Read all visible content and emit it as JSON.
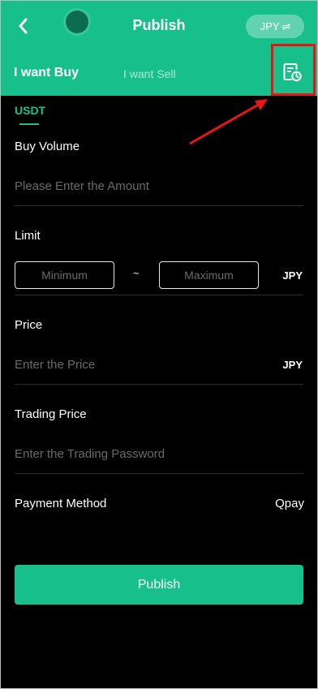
{
  "header": {
    "title": "Publish",
    "currency": "JPY",
    "currency_swap_glyph": "⇌",
    "back_icon": "chevron-left-icon",
    "history_icon": "order-history-icon",
    "accent_color": "#17c08a"
  },
  "tabs": {
    "buy": "I want Buy",
    "sell": "I want Sell",
    "active": "buy"
  },
  "coin_tab": "USDT",
  "form": {
    "buy_volume": {
      "label": "Buy Volume",
      "placeholder": "Please Enter the Amount"
    },
    "limit": {
      "label": "Limit",
      "min_placeholder": "Minimum",
      "separator": "~",
      "max_placeholder": "Maximum",
      "unit": "JPY"
    },
    "price": {
      "label": "Price",
      "placeholder": "Enter the Price",
      "unit": "JPY"
    },
    "trading": {
      "label": "Trading Price",
      "placeholder": "Enter the Trading Password"
    },
    "payment": {
      "label": "Payment Method",
      "value": "Qpay"
    }
  },
  "submit_label": "Publish",
  "annotation": {
    "highlight_color": "#e81515"
  }
}
